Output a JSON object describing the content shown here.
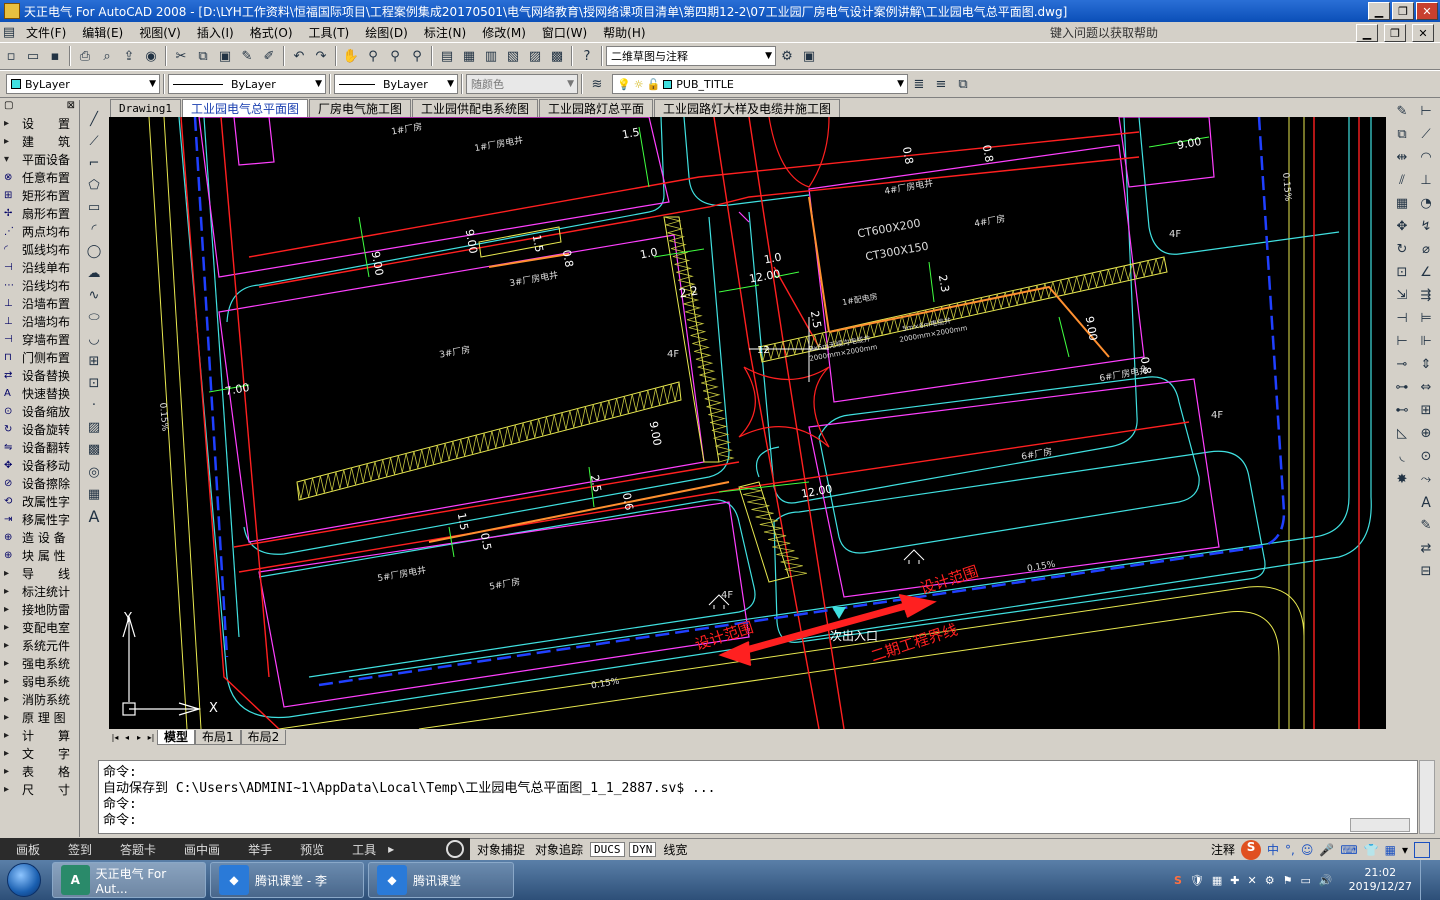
{
  "titlebar": {
    "title": "天正电气 For AutoCAD 2008 - [D:\\LYH工作资料\\恒福国际项目\\工程案例集成20170501\\电气网络教育\\授网络课项目清单\\第四期12-2\\07工业园厂房电气设计案例讲解\\工业园电气总平面图.dwg]",
    "min": "0",
    "max": "1",
    "close": "r"
  },
  "menu": {
    "items": [
      "文件(F)",
      "编辑(E)",
      "视图(V)",
      "插入(I)",
      "格式(O)",
      "工具(T)",
      "绘图(D)",
      "标注(N)",
      "修改(M)",
      "窗口(W)",
      "帮助(H)"
    ],
    "help_prompt": "键入问题以获取帮助"
  },
  "toolbar": {
    "workspace": "二维草图与注释",
    "color": "ByLayer",
    "linetype": "ByLayer",
    "lineweight": "ByLayer",
    "plotstyle": "随颜色",
    "layer": "PUB_TITLE"
  },
  "tabs": [
    "Drawing1",
    "工业园电气总平面图",
    "厂房电气施工图",
    "工业园供配电系统图",
    "工业园路灯总平面",
    "工业园路灯大样及电缆井施工图"
  ],
  "left_panel": {
    "header_left": "▢",
    "header_right": "⊠",
    "items": [
      {
        "icon": "▸",
        "label": "设　　置",
        "cat": true
      },
      {
        "icon": "▸",
        "label": "建　　筑",
        "cat": true
      },
      {
        "icon": "▾",
        "label": "平面设备",
        "cat": true
      },
      {
        "icon": "⊗",
        "label": "任意布置",
        "cat": false
      },
      {
        "icon": "⊞",
        "label": "矩形布置",
        "cat": false
      },
      {
        "icon": "✢",
        "label": "扇形布置",
        "cat": false
      },
      {
        "icon": "⋰",
        "label": "两点均布",
        "cat": false
      },
      {
        "icon": "◜",
        "label": "弧线均布",
        "cat": false
      },
      {
        "icon": "⊣",
        "label": "沿线单布",
        "cat": false
      },
      {
        "icon": "⋯",
        "label": "沿线均布",
        "cat": false
      },
      {
        "icon": "⊥",
        "label": "沿墙布置",
        "cat": false
      },
      {
        "icon": "⊥",
        "label": "沿墙均布",
        "cat": false
      },
      {
        "icon": "⊣",
        "label": "穿墙布置",
        "cat": false
      },
      {
        "icon": "⊓",
        "label": "门侧布置",
        "cat": false
      },
      {
        "icon": "⇄",
        "label": "设备替换",
        "cat": false
      },
      {
        "icon": "A",
        "label": "快速替换",
        "cat": false
      },
      {
        "icon": "⊙",
        "label": "设备缩放",
        "cat": false
      },
      {
        "icon": "↻",
        "label": "设备旋转",
        "cat": false
      },
      {
        "icon": "⇋",
        "label": "设备翻转",
        "cat": false
      },
      {
        "icon": "✥",
        "label": "设备移动",
        "cat": false
      },
      {
        "icon": "⊘",
        "label": "设备擦除",
        "cat": false
      },
      {
        "icon": "⟲",
        "label": "改属性字",
        "cat": false
      },
      {
        "icon": "⇥",
        "label": "移属性字",
        "cat": false
      },
      {
        "icon": "⊕",
        "label": "造 设 备",
        "cat": false
      },
      {
        "icon": "⊕",
        "label": "块 属 性",
        "cat": false
      },
      {
        "icon": "▸",
        "label": "导　　线",
        "cat": true
      },
      {
        "icon": "▸",
        "label": "标注统计",
        "cat": true
      },
      {
        "icon": "▸",
        "label": "接地防雷",
        "cat": true
      },
      {
        "icon": "▸",
        "label": "变配电室",
        "cat": true
      },
      {
        "icon": "▸",
        "label": "系统元件",
        "cat": true
      },
      {
        "icon": "▸",
        "label": "强电系统",
        "cat": true
      },
      {
        "icon": "▸",
        "label": "弱电系统",
        "cat": true
      },
      {
        "icon": "▸",
        "label": "消防系统",
        "cat": true
      },
      {
        "icon": "▸",
        "label": "原 理 图",
        "cat": true
      },
      {
        "icon": "▸",
        "label": "计　　算",
        "cat": true
      },
      {
        "icon": "▸",
        "label": "文　　字",
        "cat": true
      },
      {
        "icon": "▸",
        "label": "表　　格",
        "cat": true
      },
      {
        "icon": "▸",
        "label": "尺　　寸",
        "cat": true
      }
    ]
  },
  "drawing": {
    "labels": {
      "b1": "1#厂房",
      "b1e": "1#厂房电井",
      "b3": "3#厂房",
      "b3e": "3#厂房电井",
      "b4": "4#厂房",
      "b4e": "4#厂房电井",
      "b5": "5#厂房",
      "b5e": "5#厂房电井",
      "b6": "6#厂房",
      "b6e": "6#厂房电井",
      "f4a": "4F",
      "f4b": "4F",
      "f4c": "4F",
      "f4d": "4F",
      "ct1": "CT600X200",
      "ct2": "CT300X150",
      "sw": "1#配电房",
      "well1": "5m×6m电缆井",
      "well2": "2000mm×2000mm",
      "well3": "2x5m无缆沟电缆井",
      "well4": "2000mm×2000mm",
      "entrance": "次出入口",
      "scope1": "设计范围",
      "scope2": "设计范围",
      "phase2": "二期工程界线",
      "d1": "1.5",
      "d2": "9.00",
      "d3": "0.8",
      "d4": "0.8",
      "d5": "9.00",
      "d6": "9.00",
      "d7": "1.5",
      "d8": "0.8",
      "d9": "1.0",
      "d10": "2.2",
      "d11": "1.0",
      "d12": "12.00",
      "d13": "2.3",
      "d14": "2.5",
      "d15": "9.00",
      "d16": "0.8",
      "d17": "7.00",
      "d18": "9.00",
      "d19": "2.5",
      "d20": "0.6",
      "d21": "1.5",
      "d22": "0.5",
      "d23": "12.00",
      "d24": "12",
      "s1": "0.15%",
      "s2": "0.15%",
      "s3": "0.15%",
      "s4": "0.15%",
      "ax_y": "Y",
      "ax_x": "X"
    }
  },
  "layout_tabs": {
    "nav": [
      "|◂",
      "◂",
      "▸",
      "▸|"
    ],
    "tabs": [
      "模型",
      "布局1",
      "布局2"
    ]
  },
  "command": {
    "lines": [
      "命令:",
      "自动保存到 C:\\Users\\ADMINI~1\\AppData\\Local\\Temp\\工业园电气总平面图_1_1_2887.sv$ ...",
      "命令:",
      "命令:"
    ]
  },
  "qq_bar": {
    "items": [
      "画板",
      "签到",
      "答题卡",
      "画中画",
      "举手",
      "预览",
      "工具"
    ],
    "more": "▸"
  },
  "statusbar": {
    "items": [
      "对象捕捉",
      "对象追踪",
      "DUCS",
      "DYN",
      "线宽"
    ],
    "right_label": "注释",
    "ime": "中"
  },
  "taskbar": {
    "apps": [
      {
        "label": "天正电气 For Aut...",
        "icon": "A",
        "active": true
      },
      {
        "label": "腾讯课堂 - 李",
        "icon": "◆",
        "active": false
      },
      {
        "label": "腾讯课堂",
        "icon": "◆",
        "active": false
      }
    ],
    "time": "21:02",
    "date": "2019/12/27"
  },
  "colors": {
    "canvas": "#000000",
    "road": "#ff2020",
    "building": "#ff40ff",
    "curb": "#40e0e0",
    "dim": "#40ff40"
  }
}
